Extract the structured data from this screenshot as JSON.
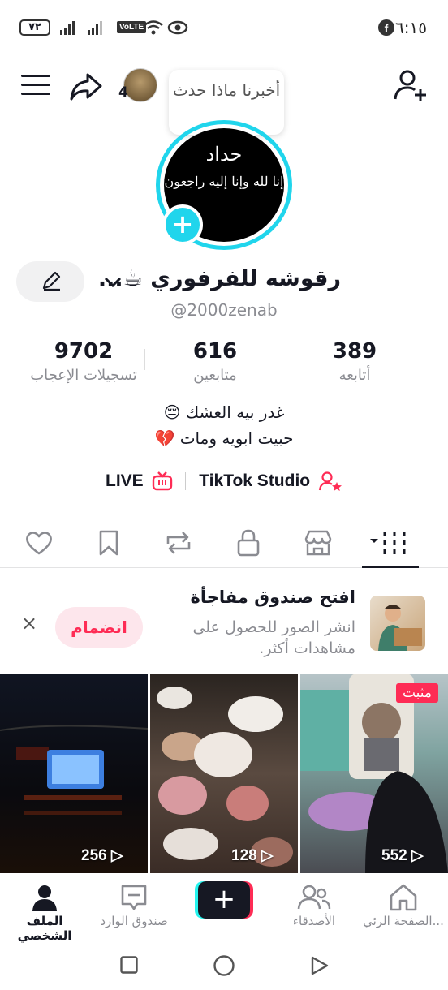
{
  "status_bar": {
    "time": "٦:١٥",
    "battery": "٧٢"
  },
  "header": {
    "notification_count": "4",
    "tooltip": "أخبرنا ماذا حدث"
  },
  "profile_pic": {
    "line1": "حداد",
    "line2": "إنا لله وإنا إليه راجعون"
  },
  "profile": {
    "name": "رقوشه للفرفوري ☕...",
    "handle": "@2000zenab"
  },
  "stats": [
    {
      "value": "9702",
      "label": "تسجيلات الإعجاب"
    },
    {
      "value": "616",
      "label": "متابعين"
    },
    {
      "value": "389",
      "label": "أتابعه"
    }
  ],
  "bio": {
    "line1": "غدر بيه العشك 😔",
    "line2": "حبيت ابويه ومات 💔"
  },
  "links": {
    "live": "LIVE",
    "studio": "TikTok Studio"
  },
  "promo": {
    "title": "افتح صندوق مفاجأة",
    "desc": "انشر الصور للحصول على مشاهدات أكثر.",
    "join": "انضمام",
    "close": "×"
  },
  "videos": [
    {
      "views": "256"
    },
    {
      "views": "128"
    },
    {
      "views": "552",
      "pinned": "مثبت"
    }
  ],
  "nav": {
    "profile": "الملف الشخصي",
    "inbox": "صندوق الوارد",
    "create": "+",
    "friends": "الأصدقاء",
    "home": "الصفحة الرئي..."
  },
  "colors": {
    "accent": "#fe2c55",
    "cyan": "#20d5ec",
    "text": "#161823",
    "muted": "#8a8b91"
  }
}
